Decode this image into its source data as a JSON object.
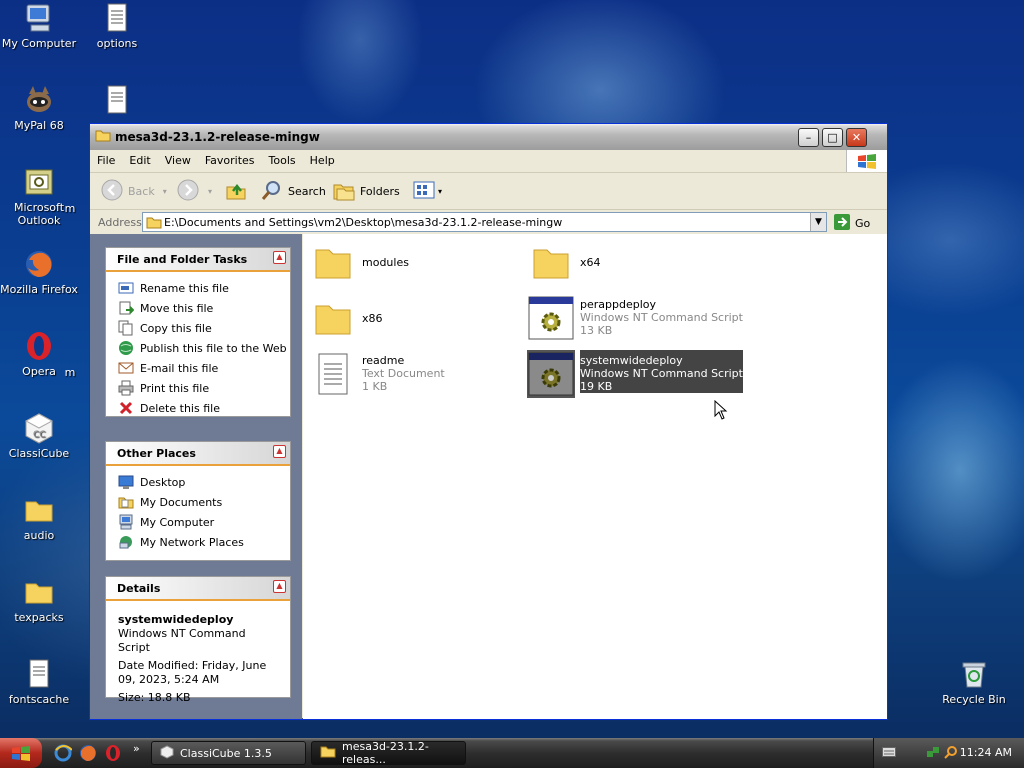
{
  "desktop": {
    "icons": [
      {
        "label": "My Computer",
        "icon": "my-computer-icon"
      },
      {
        "label": "options",
        "icon": "text-file-icon"
      },
      {
        "label": "MyPal 68",
        "icon": "mypal-icon"
      },
      {
        "label": "",
        "icon": "text-file-icon"
      },
      {
        "label": "Microsoft Outlook",
        "icon": "outlook-icon"
      },
      {
        "label": "Mozilla Firefox",
        "icon": "firefox-icon"
      },
      {
        "label": "Opera",
        "icon": "opera-icon"
      },
      {
        "label": "ClassiCube",
        "icon": "classicube-icon"
      },
      {
        "label": "audio",
        "icon": "folder-icon"
      },
      {
        "label": "texpacks",
        "icon": "folder-icon"
      },
      {
        "label": "fontscache",
        "icon": "text-file-icon"
      },
      {
        "label": "Recycle Bin",
        "icon": "recycle-bin-icon"
      }
    ],
    "partial_labels": [
      "m",
      "m"
    ]
  },
  "window": {
    "title": "mesa3d-23.1.2-release-mingw",
    "menu": [
      "File",
      "Edit",
      "View",
      "Favorites",
      "Tools",
      "Help"
    ],
    "toolbar": {
      "back": "Back",
      "search": "Search",
      "folders": "Folders"
    },
    "address": {
      "label": "Address",
      "value": "E:\\Documents and Settings\\vm2\\Desktop\\mesa3d-23.1.2-release-mingw",
      "go": "Go"
    },
    "tasks": {
      "title": "File and Folder Tasks",
      "items": [
        "Rename this file",
        "Move this file",
        "Copy this file",
        "Publish this file to the Web",
        "E-mail this file",
        "Print this file",
        "Delete this file"
      ]
    },
    "places": {
      "title": "Other Places",
      "items": [
        "Desktop",
        "My Documents",
        "My Computer",
        "My Network Places"
      ]
    },
    "details": {
      "title": "Details",
      "name": "systemwidedeploy",
      "type": "Windows NT Command Script",
      "modified": "Date Modified: Friday, June 09, 2023, 5:24 AM",
      "size": "Size: 18.8 KB"
    },
    "files": [
      {
        "name": "modules",
        "type": "",
        "size": "",
        "kind": "folder"
      },
      {
        "name": "x64",
        "type": "",
        "size": "",
        "kind": "folder"
      },
      {
        "name": "x86",
        "type": "",
        "size": "",
        "kind": "folder"
      },
      {
        "name": "perappdeploy",
        "type": "Windows NT Command Script",
        "size": "13 KB",
        "kind": "script"
      },
      {
        "name": "readme",
        "type": "Text Document",
        "size": "1 KB",
        "kind": "text"
      },
      {
        "name": "systemwidedeploy",
        "type": "Windows NT Command Script",
        "size": "19 KB",
        "kind": "script",
        "selected": true
      }
    ]
  },
  "taskbar": {
    "buttons": [
      "ClassiCube 1.3.5",
      "mesa3d-23.1.2-releas..."
    ],
    "clock": "11:24 AM"
  }
}
